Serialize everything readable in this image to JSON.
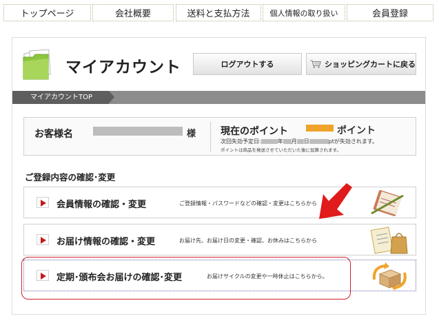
{
  "nav": {
    "items": [
      {
        "label": "トップページ"
      },
      {
        "label": "会社概要"
      },
      {
        "label": "送料と支払方法"
      },
      {
        "label": "個人情報の取り扱い"
      },
      {
        "label": "会員登録"
      }
    ]
  },
  "header": {
    "title": "マイアカウント",
    "logout_label": "ログアウトする",
    "cart_label": "ショッピングカートに戻る"
  },
  "breadcrumb": {
    "current": "マイアカウントTOP"
  },
  "customer": {
    "label": "お客様名",
    "suffix": "様",
    "points_label": "現在のポイント",
    "points_unit": "ポイント",
    "expiry_prefix": "次回失効予定日:",
    "expiry_year": "年",
    "expiry_month": "月",
    "expiry_day": "日",
    "expiry_suffix": "ptが失効されます。",
    "points_note": "ポイントは商品を発送させていただいた後に加算されます。"
  },
  "section": {
    "title": "ご登録内容の確認･変更",
    "rows": [
      {
        "title": "会員情報の確認・変更",
        "desc": "ご登録情報・パスワードなどの確認・変更はこちらから",
        "icon": "notebook-pen-icon"
      },
      {
        "title": "お届け情報の確認・変更",
        "desc": "お届け先、お届け日の変更・確認、お休みはこちらから",
        "icon": "clipboard-bag-icon"
      },
      {
        "title": "定期･頒布会お届けの確認･変更",
        "desc": "お届けサイクルの変更や一時休止はこちらから。",
        "icon": "box-cycle-icon"
      }
    ]
  },
  "colors": {
    "accent_red": "#c41a1a",
    "points_highlight": "#f0a32a",
    "breadcrumb_bg": "#8c8c8c",
    "folder_green": "#8cc63f"
  }
}
